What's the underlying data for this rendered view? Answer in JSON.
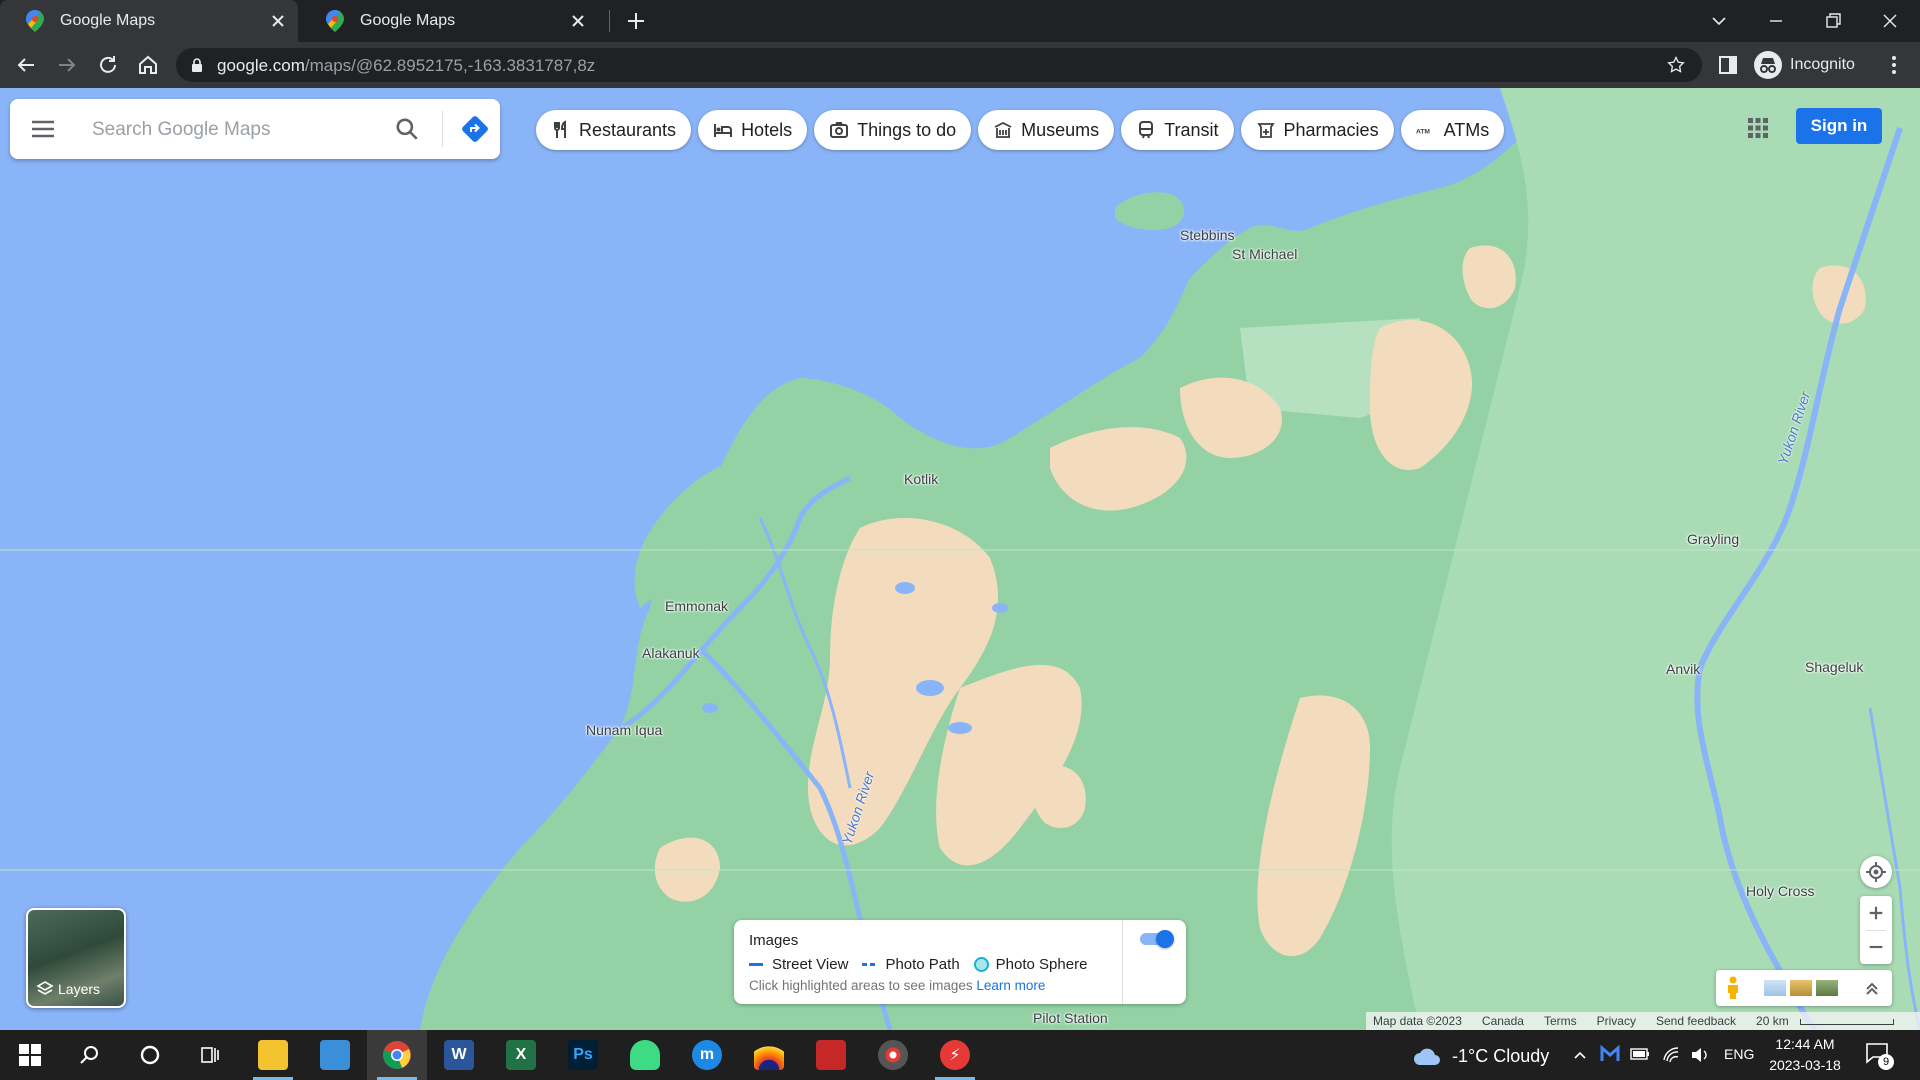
{
  "browser": {
    "tabs": [
      {
        "title": "Google Maps",
        "active": true
      },
      {
        "title": "Google Maps",
        "active": false
      }
    ],
    "url_host": "google.com",
    "url_path": "/maps/@62.8952175,-163.3831787,8z",
    "profile_label": "Incognito"
  },
  "search": {
    "placeholder": "Search Google Maps"
  },
  "chips": [
    {
      "label": "Restaurants",
      "icon": "fork-knife-icon"
    },
    {
      "label": "Hotels",
      "icon": "bed-icon"
    },
    {
      "label": "Things to do",
      "icon": "camera-icon"
    },
    {
      "label": "Museums",
      "icon": "museum-icon"
    },
    {
      "label": "Transit",
      "icon": "train-icon"
    },
    {
      "label": "Pharmacies",
      "icon": "pharmacy-icon"
    },
    {
      "label": "ATMs",
      "icon": "atm-icon"
    }
  ],
  "signin_label": "Sign in",
  "places": {
    "stebbins": "Stebbins",
    "st_michael": "St Michael",
    "kotlik": "Kotlik",
    "emmonak": "Emmonak",
    "alakanuk": "Alakanuk",
    "nunam_iqua": "Nunam Iqua",
    "grayling": "Grayling",
    "anvik": "Anvik",
    "shageluk": "Shageluk",
    "holy_cross": "Holy Cross",
    "pilot_station": "Pilot Station",
    "yukon_river_1": "Yukon River",
    "yukon_river_2": "Yukon River"
  },
  "layers_label": "Layers",
  "images_panel": {
    "title": "Images",
    "street_view": "Street View",
    "photo_path": "Photo Path",
    "photo_sphere": "Photo Sphere",
    "hint": "Click highlighted areas to see images",
    "learn_more": "Learn more"
  },
  "attribution": {
    "map_data": "Map data ©2023",
    "canada": "Canada",
    "terms": "Terms",
    "privacy": "Privacy",
    "feedback": "Send feedback",
    "scale": "20 km"
  },
  "taskbar": {
    "weather": "-1°C  Cloudy",
    "lang": "ENG",
    "time": "12:44 AM",
    "date": "2023-03-18",
    "notifications": "9"
  },
  "colors": {
    "water": "#8ab4f8",
    "land": "#94d2a5",
    "sand": "#f2dcbd",
    "accent": "#1a73e8"
  }
}
